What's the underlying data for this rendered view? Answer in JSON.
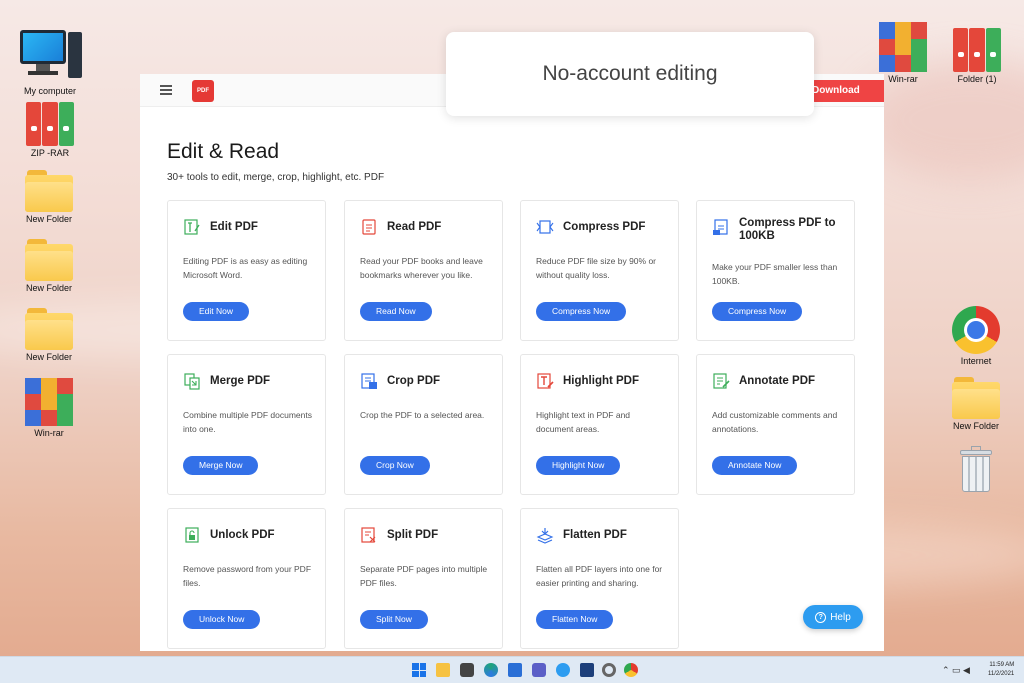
{
  "desktop": {
    "left_icons": [
      {
        "label": "My computer"
      },
      {
        "label": "ZIP -RAR"
      },
      {
        "label": "New Folder"
      },
      {
        "label": "New Folder"
      },
      {
        "label": "New Folder"
      },
      {
        "label": "Win-rar"
      }
    ],
    "right_icons": [
      {
        "label": "Win-rar"
      },
      {
        "label": "Folder (1)"
      },
      {
        "label": "Internet"
      },
      {
        "label": "New Folder"
      },
      {
        "label": "Recycle Bin"
      }
    ]
  },
  "overlay": {
    "text": "No-account editing"
  },
  "app": {
    "logo_text": "PDF",
    "download_label": "Download",
    "heading": "Edit & Read",
    "subheading": "30+ tools to edit, merge, crop, highlight, etc. PDF",
    "tools": [
      {
        "title": "Edit PDF",
        "desc": "Editing PDF is as easy as editing Microsoft Word.",
        "button": "Edit Now",
        "icon": "edit-pdf-icon"
      },
      {
        "title": "Read PDF",
        "desc": "Read your PDF books and leave bookmarks wherever you like.",
        "button": "Read Now",
        "icon": "read-pdf-icon"
      },
      {
        "title": "Compress PDF",
        "desc": "Reduce PDF file size by 90% or without quality loss.",
        "button": "Compress Now",
        "icon": "compress-pdf-icon"
      },
      {
        "title": "Compress PDF to 100KB",
        "desc": "Make your PDF smaller less than 100KB.",
        "button": "Compress Now",
        "icon": "compress-100kb-icon"
      },
      {
        "title": "Merge PDF",
        "desc": "Combine multiple PDF documents into one.",
        "button": "Merge Now",
        "icon": "merge-pdf-icon"
      },
      {
        "title": "Crop PDF",
        "desc": "Crop the PDF to a selected area.",
        "button": "Crop Now",
        "icon": "crop-pdf-icon"
      },
      {
        "title": "Highlight PDF",
        "desc": "Highlight text in PDF and document areas.",
        "button": "Highlight Now",
        "icon": "highlight-pdf-icon"
      },
      {
        "title": "Annotate PDF",
        "desc": "Add customizable comments and annotations.",
        "button": "Annotate Now",
        "icon": "annotate-pdf-icon"
      },
      {
        "title": "Unlock PDF",
        "desc": "Remove password from your PDF files.",
        "button": "Unlock Now",
        "icon": "unlock-pdf-icon"
      },
      {
        "title": "Split PDF",
        "desc": "Separate PDF pages into multiple PDF files.",
        "button": "Split Now",
        "icon": "split-pdf-icon"
      },
      {
        "title": "Flatten PDF",
        "desc": "Flatten all PDF layers into one for easier printing and sharing.",
        "button": "Flatten Now",
        "icon": "flatten-pdf-icon"
      }
    ],
    "help_label": "Help"
  },
  "taskbar": {
    "time": "11:59 AM",
    "date": "11/2/2021"
  },
  "colors": {
    "primary_button": "#3370e8",
    "download": "#ef4444",
    "help": "#2d9cf0"
  }
}
